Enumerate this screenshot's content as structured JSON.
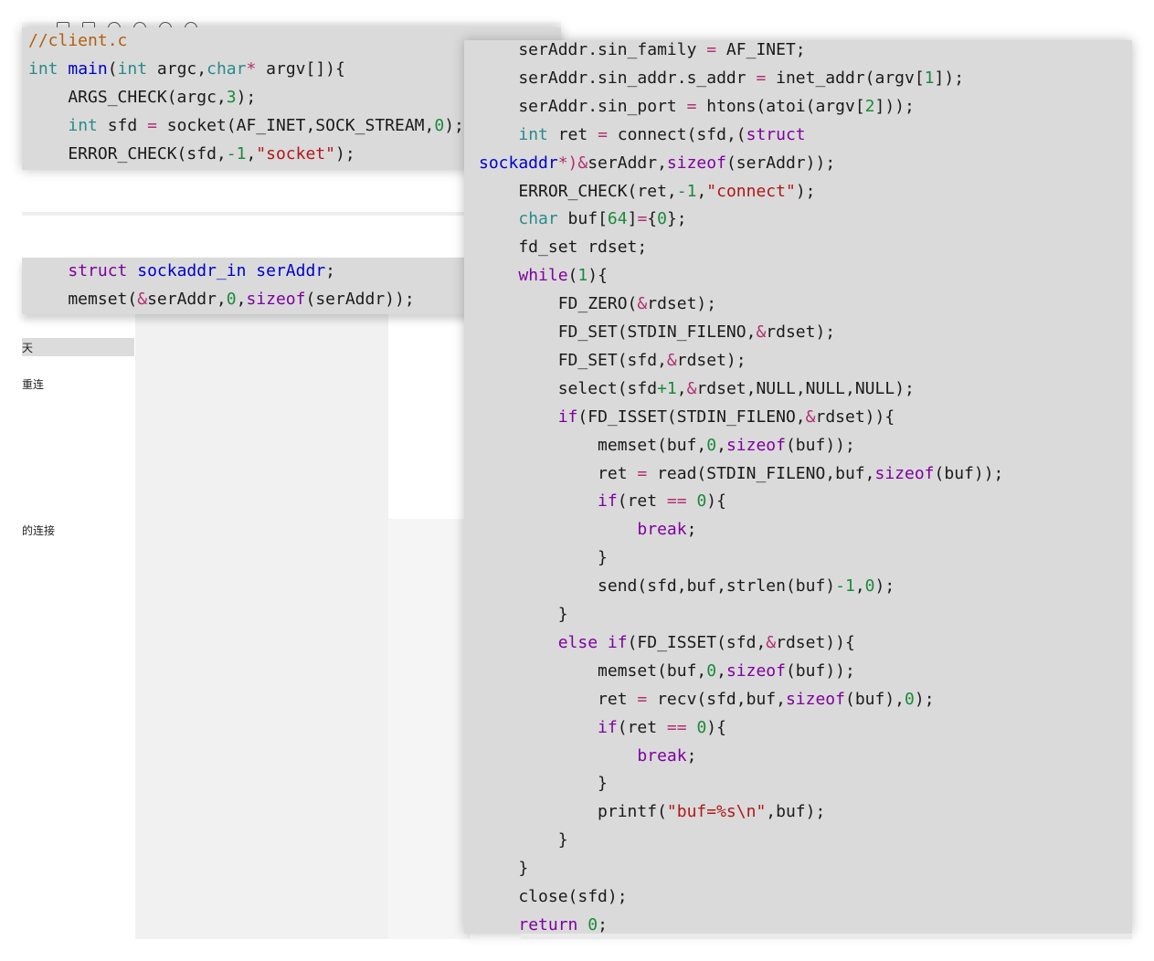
{
  "sidebar": {
    "items": [
      "天",
      "重连",
      "的连接"
    ]
  },
  "back_editor": {
    "lines": [
      [
        {
          "t": "//client.c",
          "c": "com"
        }
      ],
      [
        {
          "t": "int",
          "c": "ty"
        },
        {
          "t": " "
        },
        {
          "t": "main",
          "c": "fn"
        },
        {
          "t": "("
        },
        {
          "t": "int",
          "c": "ty"
        },
        {
          "t": " argc,"
        },
        {
          "t": "char",
          "c": "ty"
        },
        {
          "t": "*",
          "c": "op"
        },
        {
          "t": " argv[]){"
        }
      ],
      [
        {
          "t": "    ARGS_CHECK(argc,"
        },
        {
          "t": "3",
          "c": "num"
        },
        {
          "t": ");"
        }
      ],
      [
        {
          "t": "    "
        },
        {
          "t": "int",
          "c": "ty"
        },
        {
          "t": " sfd "
        },
        {
          "t": "=",
          "c": "op"
        },
        {
          "t": " socket(AF_INET,SOCK_STREAM,"
        },
        {
          "t": "0",
          "c": "num"
        },
        {
          "t": ");"
        }
      ],
      [
        {
          "t": "    ERROR_CHECK(sfd,"
        },
        {
          "t": "-1",
          "c": "num"
        },
        {
          "t": ","
        },
        {
          "t": "\"socket\"",
          "c": "str"
        },
        {
          "t": ");"
        }
      ]
    ],
    "lines2": [
      [
        {
          "t": "    "
        },
        {
          "t": "struct",
          "c": "kw"
        },
        {
          "t": " "
        },
        {
          "t": "sockaddr_in",
          "c": "fn"
        },
        {
          "t": " "
        },
        {
          "t": "serAddr",
          "c": "fn"
        },
        {
          "t": ";"
        }
      ],
      [
        {
          "t": "    memset("
        },
        {
          "t": "&",
          "c": "op"
        },
        {
          "t": "serAddr,"
        },
        {
          "t": "0",
          "c": "num"
        },
        {
          "t": ","
        },
        {
          "t": "sizeof",
          "c": "kw"
        },
        {
          "t": "(serAddr));"
        }
      ]
    ]
  },
  "front_editor": {
    "lines": [
      [
        {
          "t": "    serAddr.sin_family "
        },
        {
          "t": "=",
          "c": "op"
        },
        {
          "t": " AF_INET;"
        }
      ],
      [
        {
          "t": "    serAddr.sin_addr.s_addr "
        },
        {
          "t": "=",
          "c": "op"
        },
        {
          "t": " inet_addr(argv["
        },
        {
          "t": "1",
          "c": "num"
        },
        {
          "t": "]);"
        }
      ],
      [
        {
          "t": "    serAddr.sin_port "
        },
        {
          "t": "=",
          "c": "op"
        },
        {
          "t": " htons(atoi(argv["
        },
        {
          "t": "2",
          "c": "num"
        },
        {
          "t": "]));"
        }
      ],
      [
        {
          "t": "    "
        },
        {
          "t": "int",
          "c": "ty"
        },
        {
          "t": " ret "
        },
        {
          "t": "=",
          "c": "op"
        },
        {
          "t": " connect(sfd,("
        },
        {
          "t": "struct",
          "c": "kw"
        }
      ],
      [
        {
          "t": "sockaddr",
          "c": "fn"
        },
        {
          "t": "*)&",
          "c": "op"
        },
        {
          "t": "serAddr,"
        },
        {
          "t": "sizeof",
          "c": "kw"
        },
        {
          "t": "(serAddr));"
        }
      ],
      [
        {
          "t": "    ERROR_CHECK(ret,"
        },
        {
          "t": "-1",
          "c": "num"
        },
        {
          "t": ","
        },
        {
          "t": "\"connect\"",
          "c": "str"
        },
        {
          "t": ");"
        }
      ],
      [
        {
          "t": "    "
        },
        {
          "t": "char",
          "c": "ty"
        },
        {
          "t": " buf["
        },
        {
          "t": "64",
          "c": "num"
        },
        {
          "t": "]"
        },
        {
          "t": "=",
          "c": "op"
        },
        {
          "t": "{"
        },
        {
          "t": "0",
          "c": "num"
        },
        {
          "t": "};"
        }
      ],
      [
        {
          "t": "    fd_set rdset;"
        }
      ],
      [
        {
          "t": "    "
        },
        {
          "t": "while",
          "c": "kw"
        },
        {
          "t": "("
        },
        {
          "t": "1",
          "c": "num"
        },
        {
          "t": "){"
        }
      ],
      [
        {
          "t": "        FD_ZERO("
        },
        {
          "t": "&",
          "c": "op"
        },
        {
          "t": "rdset);"
        }
      ],
      [
        {
          "t": "        FD_SET(STDIN_FILENO,"
        },
        {
          "t": "&",
          "c": "op"
        },
        {
          "t": "rdset);"
        }
      ],
      [
        {
          "t": "        FD_SET(sfd,"
        },
        {
          "t": "&",
          "c": "op"
        },
        {
          "t": "rdset);"
        }
      ],
      [
        {
          "t": "        select(sfd"
        },
        {
          "t": "+1",
          "c": "num"
        },
        {
          "t": ","
        },
        {
          "t": "&",
          "c": "op"
        },
        {
          "t": "rdset,NULL,NULL,NULL);"
        }
      ],
      [
        {
          "t": "        "
        },
        {
          "t": "if",
          "c": "kw"
        },
        {
          "t": "(FD_ISSET(STDIN_FILENO,"
        },
        {
          "t": "&",
          "c": "op"
        },
        {
          "t": "rdset)){"
        }
      ],
      [
        {
          "t": "            memset(buf,"
        },
        {
          "t": "0",
          "c": "num"
        },
        {
          "t": ","
        },
        {
          "t": "sizeof",
          "c": "kw"
        },
        {
          "t": "(buf));"
        }
      ],
      [
        {
          "t": "            ret "
        },
        {
          "t": "=",
          "c": "op"
        },
        {
          "t": " read(STDIN_FILENO,buf,"
        },
        {
          "t": "sizeof",
          "c": "kw"
        },
        {
          "t": "(buf));"
        }
      ],
      [
        {
          "t": "            "
        },
        {
          "t": "if",
          "c": "kw"
        },
        {
          "t": "(ret "
        },
        {
          "t": "==",
          "c": "op"
        },
        {
          "t": " "
        },
        {
          "t": "0",
          "c": "num"
        },
        {
          "t": "){"
        }
      ],
      [
        {
          "t": "                "
        },
        {
          "t": "break",
          "c": "kw"
        },
        {
          "t": ";"
        }
      ],
      [
        {
          "t": "            }"
        }
      ],
      [
        {
          "t": "            send(sfd,buf,strlen(buf)"
        },
        {
          "t": "-1",
          "c": "num"
        },
        {
          "t": ","
        },
        {
          "t": "0",
          "c": "num"
        },
        {
          "t": ");"
        }
      ],
      [
        {
          "t": "        }"
        }
      ],
      [
        {
          "t": "        "
        },
        {
          "t": "else if",
          "c": "kw"
        },
        {
          "t": "(FD_ISSET(sfd,"
        },
        {
          "t": "&",
          "c": "op"
        },
        {
          "t": "rdset)){"
        }
      ],
      [
        {
          "t": "            memset(buf,"
        },
        {
          "t": "0",
          "c": "num"
        },
        {
          "t": ","
        },
        {
          "t": "sizeof",
          "c": "kw"
        },
        {
          "t": "(buf));"
        }
      ],
      [
        {
          "t": "            ret "
        },
        {
          "t": "=",
          "c": "op"
        },
        {
          "t": " recv(sfd,buf,"
        },
        {
          "t": "sizeof",
          "c": "kw"
        },
        {
          "t": "(buf),"
        },
        {
          "t": "0",
          "c": "num"
        },
        {
          "t": ");"
        }
      ],
      [
        {
          "t": "            "
        },
        {
          "t": "if",
          "c": "kw"
        },
        {
          "t": "(ret "
        },
        {
          "t": "==",
          "c": "op"
        },
        {
          "t": " "
        },
        {
          "t": "0",
          "c": "num"
        },
        {
          "t": "){"
        }
      ],
      [
        {
          "t": "                "
        },
        {
          "t": "break",
          "c": "kw"
        },
        {
          "t": ";"
        }
      ],
      [
        {
          "t": "            }"
        }
      ],
      [
        {
          "t": "            printf("
        },
        {
          "t": "\"buf=%s\\n\"",
          "c": "str"
        },
        {
          "t": ",buf);"
        }
      ],
      [
        {
          "t": "        }"
        }
      ],
      [
        {
          "t": "    }"
        }
      ],
      [
        {
          "t": "    close(sfd);"
        }
      ],
      [
        {
          "t": "    "
        },
        {
          "t": "return",
          "c": "kw"
        },
        {
          "t": " "
        },
        {
          "t": "0",
          "c": "num"
        },
        {
          "t": ";"
        }
      ]
    ]
  },
  "colors": {
    "editor_bg": "#dadada",
    "page_bg": "#ffffff",
    "panel_bg": "#f1f1f1"
  }
}
